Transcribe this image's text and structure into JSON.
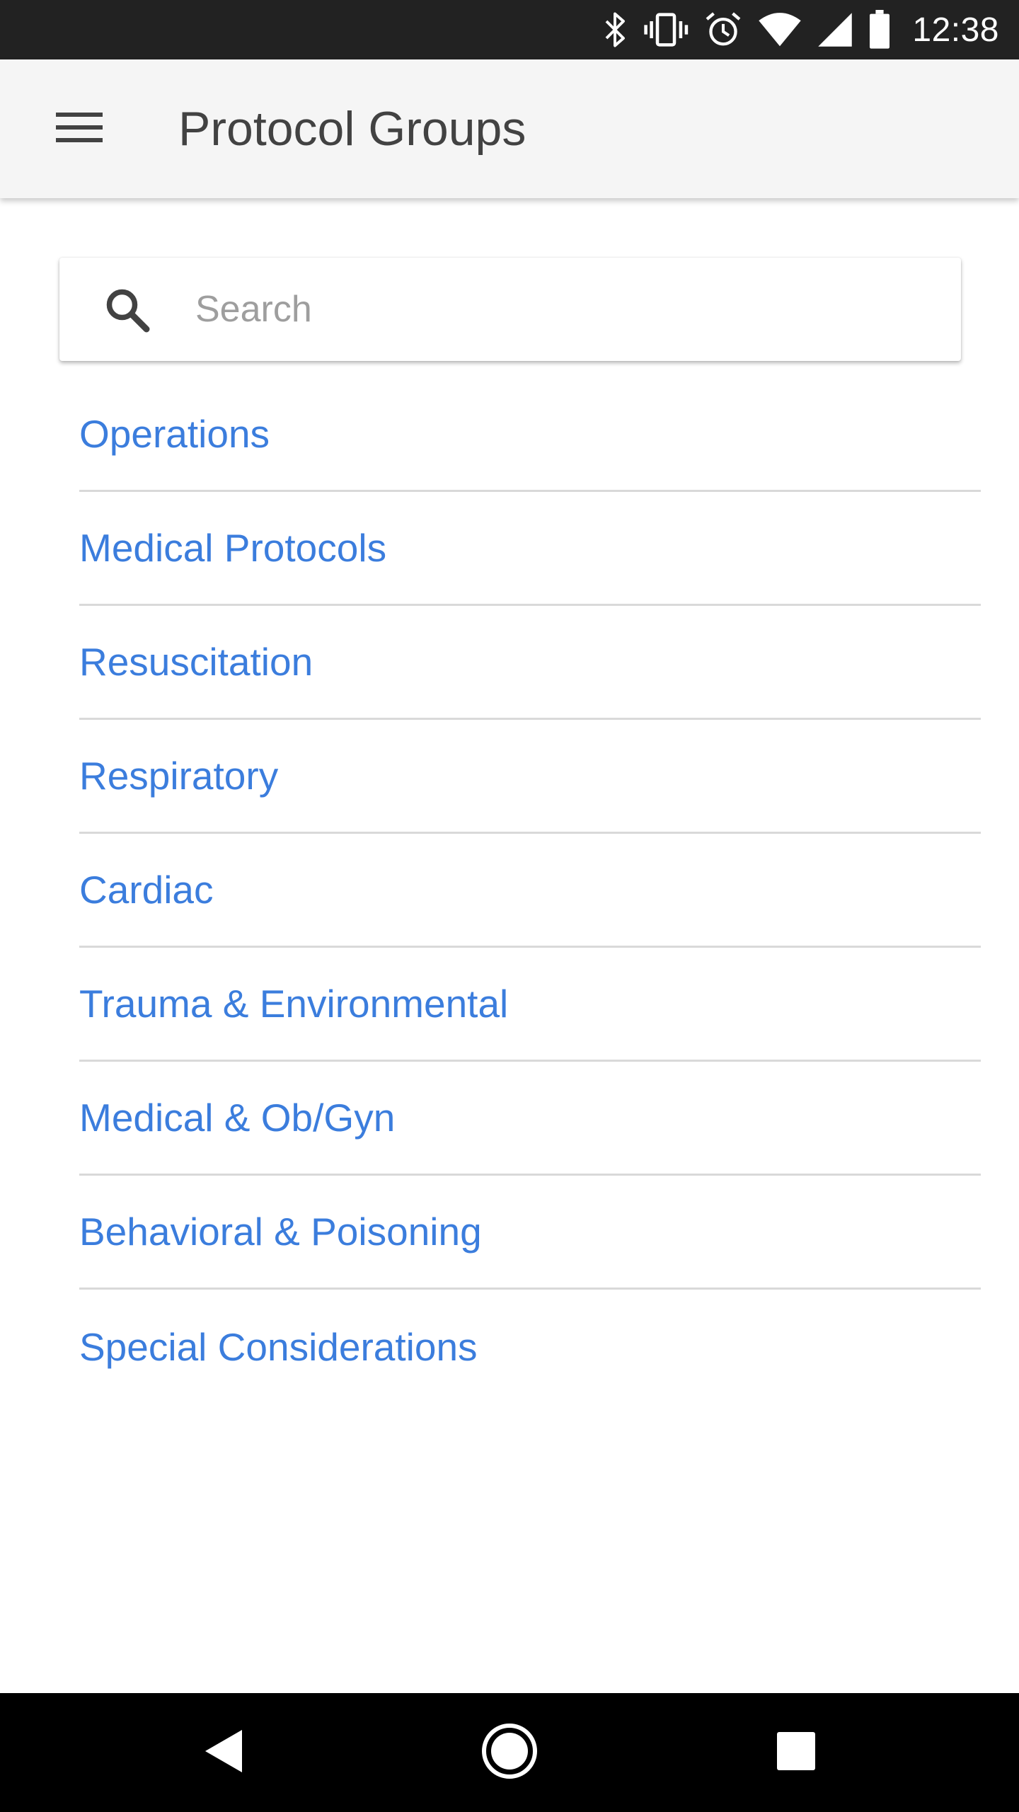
{
  "status_bar": {
    "time": "12:38",
    "icons": [
      "bluetooth-icon",
      "vibrate-icon",
      "alarm-icon",
      "wifi-icon",
      "signal-icon",
      "battery-icon"
    ]
  },
  "app_bar": {
    "title": "Protocol Groups",
    "menu_icon": "hamburger-menu-icon"
  },
  "search": {
    "placeholder": "Search",
    "value": "",
    "icon": "search-icon"
  },
  "groups": [
    {
      "label": "Operations"
    },
    {
      "label": "Medical Protocols"
    },
    {
      "label": "Resuscitation"
    },
    {
      "label": "Respiratory"
    },
    {
      "label": "Cardiac"
    },
    {
      "label": "Trauma & Environmental"
    },
    {
      "label": "Medical & Ob/Gyn"
    },
    {
      "label": "Behavioral & Poisoning"
    },
    {
      "label": "Special Considerations"
    }
  ],
  "nav_bar": {
    "buttons": [
      "back-icon",
      "home-icon",
      "recents-icon"
    ]
  },
  "colors": {
    "status_bar_bg": "#222222",
    "app_bar_bg": "#f5f5f5",
    "link_blue": "#3b7ddd",
    "divider": "#d9d9d9",
    "nav_bar_bg": "#000000"
  }
}
